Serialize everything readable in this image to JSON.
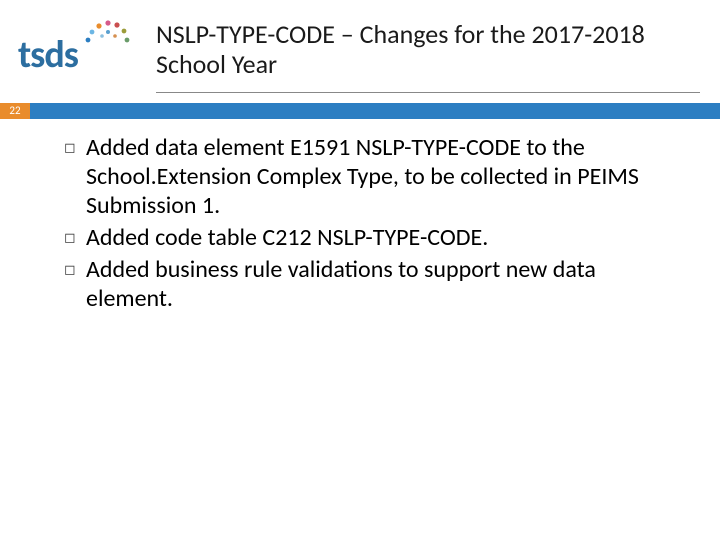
{
  "logo": {
    "text": "tsds"
  },
  "title": "NSLP-TYPE-CODE –  Changes for the 2017-2018 School Year",
  "page_number": "22",
  "bullets": [
    "Added data element E1591 NSLP-TYPE-CODE to the School.Extension Complex Type, to be collected in PEIMS Submission 1.",
    "Added code table C212 NSLP-TYPE-CODE.",
    "Added business rule validations to support new data element."
  ],
  "colors": {
    "accent_orange": "#e98c2c",
    "accent_blue": "#2c7ec2",
    "logo_blue": "#2c6ea0"
  }
}
